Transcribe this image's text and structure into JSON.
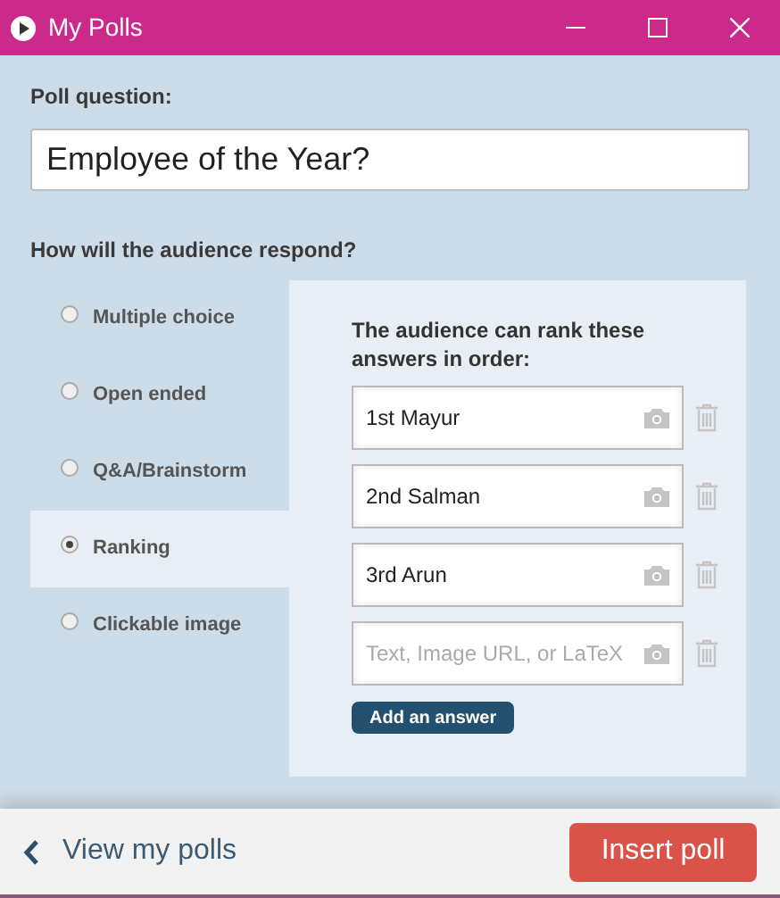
{
  "window": {
    "title": "My Polls"
  },
  "poll_question": {
    "label": "Poll question:",
    "value": "Employee of the Year?"
  },
  "response_label": "How will the audience respond?",
  "response_types": [
    {
      "label": "Multiple choice",
      "selected": false
    },
    {
      "label": "Open ended",
      "selected": false
    },
    {
      "label": "Q&A/Brainstorm",
      "selected": false
    },
    {
      "label": "Ranking",
      "selected": true
    },
    {
      "label": "Clickable image",
      "selected": false
    }
  ],
  "ranking": {
    "instructions": "The audience can rank these answers in order:",
    "answers": [
      {
        "value": "1st Mayur"
      },
      {
        "value": "2nd Salman"
      },
      {
        "value": "3rd Arun"
      },
      {
        "placeholder": "Text, Image URL, or LaTeX"
      }
    ],
    "add_button": "Add an answer"
  },
  "footer": {
    "back_link": "View my polls",
    "insert_button": "Insert poll"
  }
}
